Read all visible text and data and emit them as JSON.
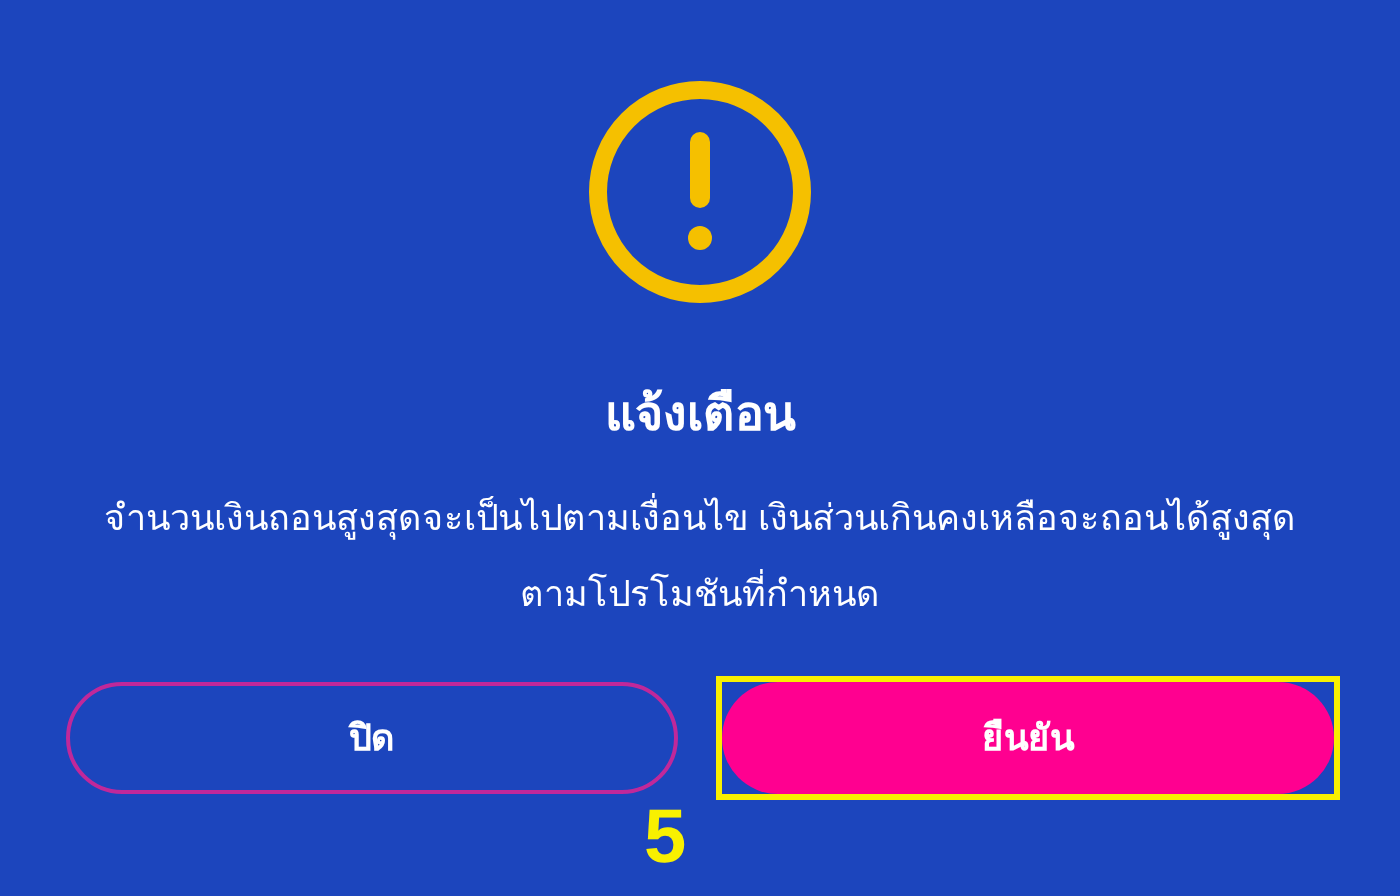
{
  "dialog": {
    "title": "แจ้งเตือน",
    "message": "จำนวนเงินถอนสูงสุดจะเป็นไปตามเงื่อนไข เงินส่วนเกินคงเหลือจะถอนได้สูงสุดตามโปรโมชันที่กำหนด",
    "buttons": [
      {
        "label": "ปิด",
        "kind": "outline",
        "highlighted": false
      },
      {
        "label": "ยืนยัน",
        "kind": "primary",
        "highlighted": true
      }
    ]
  },
  "step_marker": "5"
}
